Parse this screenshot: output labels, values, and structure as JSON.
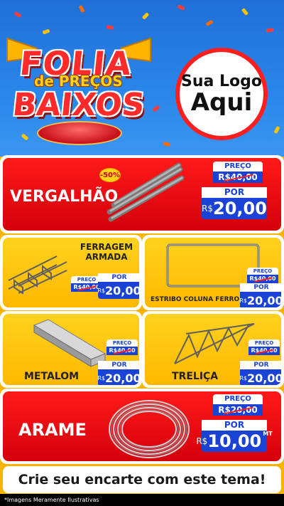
{
  "header": {
    "title_line1": "FOLIA",
    "title_line2": "de PREÇOS",
    "title_line3": "BAIXOS",
    "logo_line1": "Sua Logo",
    "logo_line2": "Aqui"
  },
  "products": {
    "vergalhao": {
      "name": "VERGALHÃO",
      "badge": "-50%",
      "price_label": "PREÇO",
      "old_price": "R$40,00",
      "por_label": "POR",
      "currency": "R$",
      "new_price": "20,00"
    },
    "ferragem": {
      "name_line1": "FERRAGEM",
      "name_line2": "ARMADA",
      "price_label": "PREÇO",
      "old_price": "R$40,00",
      "por_label": "POR",
      "currency": "R$",
      "new_price": "20,00"
    },
    "estribo": {
      "name": "ESTRIBO COLUNA FERRO",
      "price_label": "PREÇO",
      "old_price": "R$40,00",
      "por_label": "POR",
      "currency": "R$",
      "new_price": "20,00"
    },
    "metalom": {
      "name": "METALOM",
      "price_label": "PREÇO",
      "old_price": "R$40,00",
      "por_label": "POR",
      "currency": "R$",
      "new_price": "20,00"
    },
    "trelica": {
      "name": "TRELIÇA",
      "price_label": "PREÇO",
      "old_price": "R$40,00",
      "por_label": "POR",
      "currency": "R$",
      "new_price": "20,00"
    },
    "arame": {
      "name": "ARAME",
      "price_label": "PREÇO",
      "old_price": "R$20,00",
      "por_label": "POR",
      "currency": "R$",
      "new_price": "10,00",
      "unit": "MT"
    }
  },
  "cta": "Crie seu encarte com este tema!",
  "footer": "*Imagens Meramente Ilustrativas",
  "colors": {
    "header_blue": "#2b86ea",
    "background_yellow": "#f6b400",
    "card_red": "#ff1a1a",
    "price_blue": "#1a43d6"
  }
}
